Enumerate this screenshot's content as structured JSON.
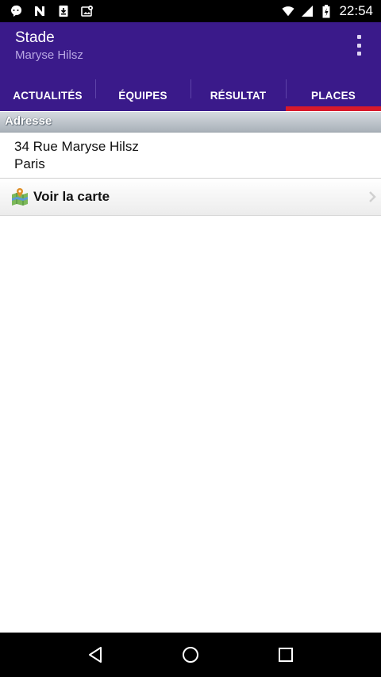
{
  "status_bar": {
    "time": "22:54",
    "icons": [
      "chat-bubble-icon",
      "n-logo-icon",
      "download-icon",
      "photo-icon",
      "wifi-icon",
      "signal-icon",
      "battery-icon"
    ]
  },
  "app_bar": {
    "title": "Stade",
    "subtitle": "Maryse Hilsz",
    "background": "#3a1a8a",
    "subtitle_color": "#b9a8e3"
  },
  "tabs": [
    {
      "label": "ACTUALITÉS",
      "active": false
    },
    {
      "label": "ÉQUIPES",
      "active": false
    },
    {
      "label": "RÉSULTAT",
      "active": false
    },
    {
      "label": "PLACES",
      "active": true
    }
  ],
  "accent_color": "#d8192a",
  "section": {
    "header": "Adresse",
    "address_line1": "34 Rue Maryse Hilsz",
    "address_line2": "Paris"
  },
  "map_link": {
    "label": "Voir la carte",
    "icon": "map-icon"
  },
  "nav_bar": {
    "buttons": [
      "back-icon",
      "home-icon",
      "recents-icon"
    ]
  }
}
